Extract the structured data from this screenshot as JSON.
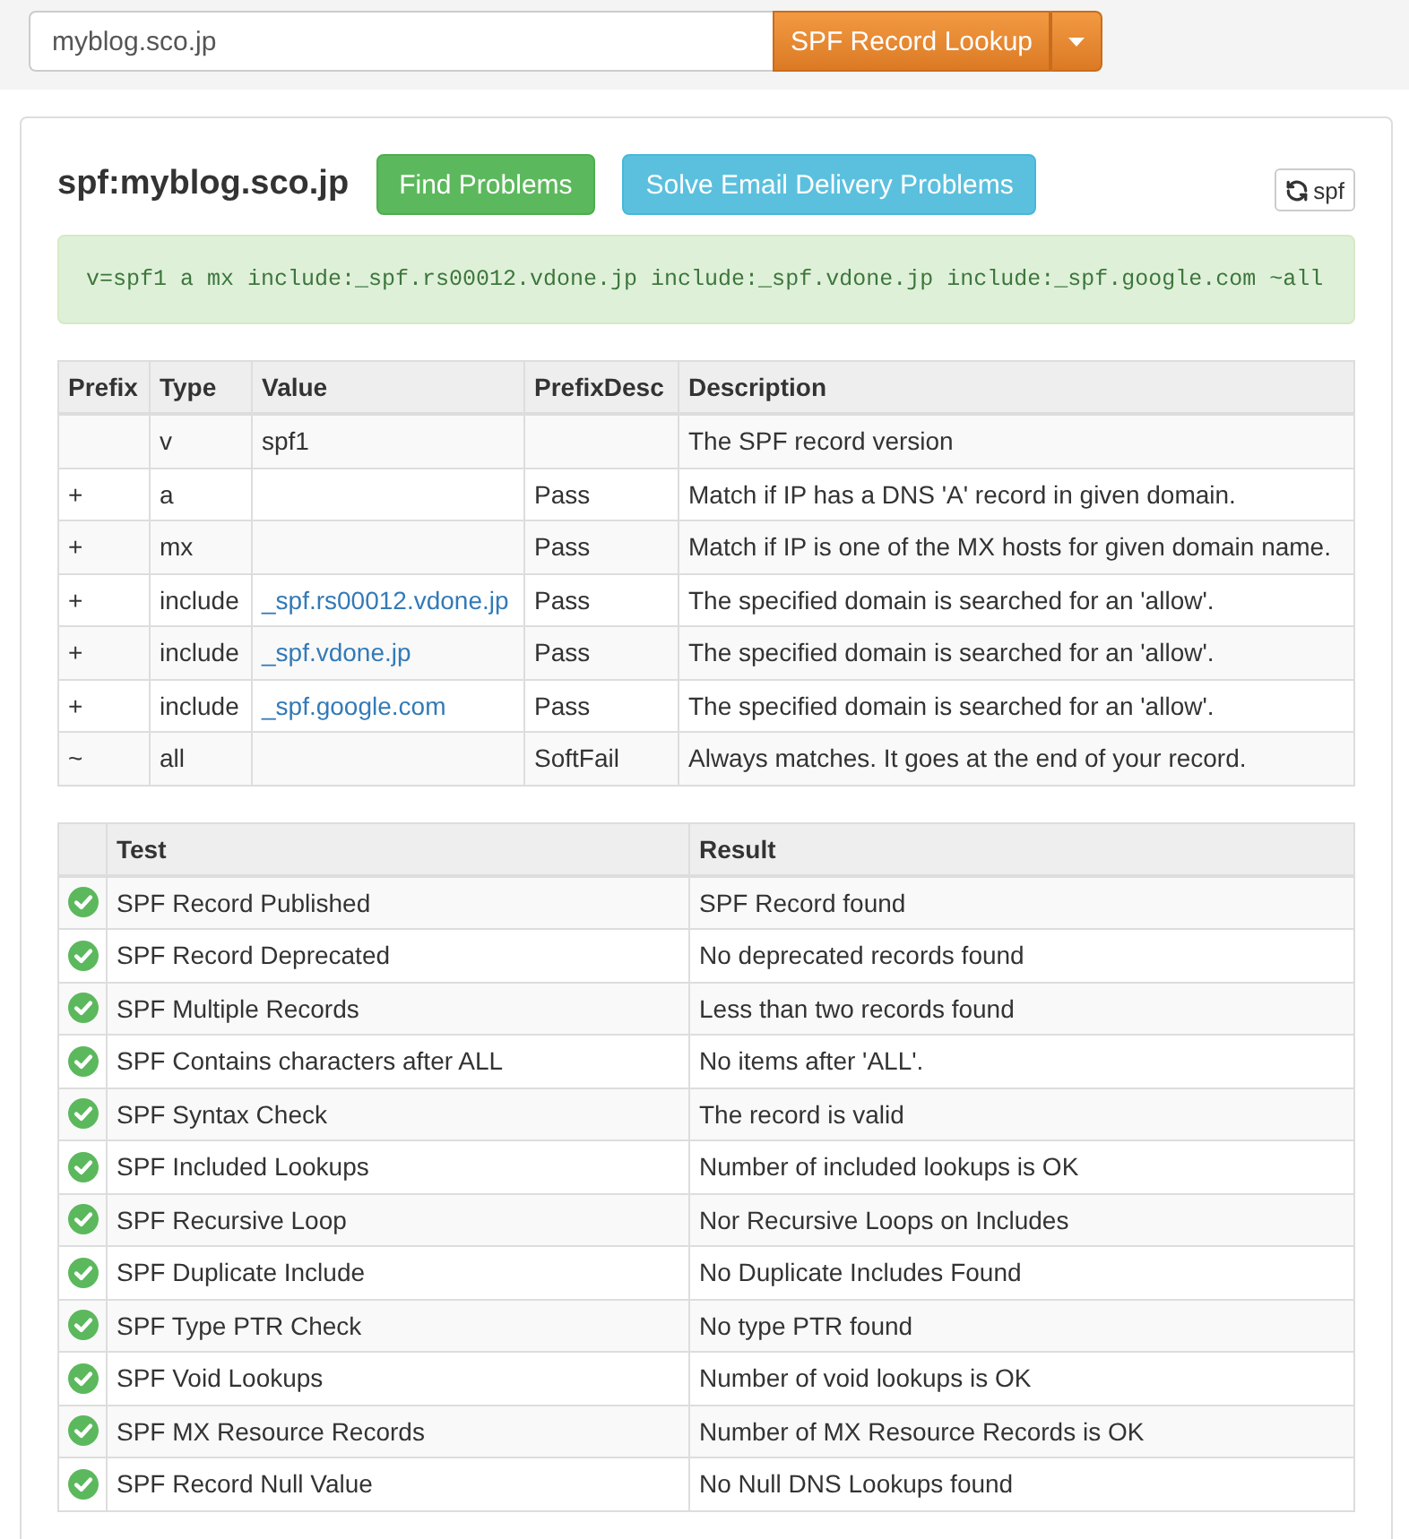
{
  "search": {
    "value": "myblog.sco.jp"
  },
  "lookup_button": {
    "label": "SPF Record Lookup"
  },
  "panel": {
    "title": "spf:myblog.sco.jp",
    "actions": [
      {
        "label": "Find Problems",
        "kind": "success"
      },
      {
        "label": "Solve Email Delivery Problems",
        "kind": "info"
      }
    ],
    "tag_button": {
      "label": "spf"
    },
    "record": "v=spf1 a mx include:_spf.rs00012.vdone.jp include:_spf.vdone.jp include:_spf.google.com ~all"
  },
  "records": {
    "columns": [
      "Prefix",
      "Type",
      "Value",
      "PrefixDesc",
      "Description"
    ],
    "rows": [
      {
        "type": "v",
        "value": "spf1",
        "value_link": false,
        "description": "The SPF record version"
      },
      {
        "prefix": "+",
        "type": "a",
        "prefix_desc": "Pass",
        "description": "Match if IP has a DNS 'A' record in given domain."
      },
      {
        "prefix": "+",
        "type": "mx",
        "prefix_desc": "Pass",
        "description": "Match if IP is one of the MX hosts for given domain name."
      },
      {
        "prefix": "+",
        "type": "include",
        "value": "_spf.rs00012.vdone.jp",
        "value_link": true,
        "prefix_desc": "Pass",
        "description": "The specified domain is searched for an 'allow'."
      },
      {
        "prefix": "+",
        "type": "include",
        "value": "_spf.vdone.jp",
        "value_link": true,
        "prefix_desc": "Pass",
        "description": "The specified domain is searched for an 'allow'."
      },
      {
        "prefix": "+",
        "type": "include",
        "value": "_spf.google.com",
        "value_link": true,
        "prefix_desc": "Pass",
        "description": "The specified domain is searched for an 'allow'."
      },
      {
        "prefix": "~",
        "type": "all",
        "prefix_desc": "SoftFail",
        "description": "Always matches. It goes at the end of your record."
      }
    ]
  },
  "tests": {
    "columns": [
      "Test",
      "Result"
    ],
    "rows": [
      {
        "passed": true,
        "test": "SPF Record Published",
        "result": "SPF Record found"
      },
      {
        "passed": true,
        "test": "SPF Record Deprecated",
        "result": "No deprecated records found"
      },
      {
        "passed": true,
        "test": "SPF Multiple Records",
        "result": "Less than two records found"
      },
      {
        "passed": true,
        "test": "SPF Contains characters after ALL",
        "result": "No items after 'ALL'."
      },
      {
        "passed": true,
        "test": "SPF Syntax Check",
        "result": "The record is valid"
      },
      {
        "passed": true,
        "test": "SPF Included Lookups",
        "result": "Number of included lookups is OK"
      },
      {
        "passed": true,
        "test": "SPF Recursive Loop",
        "result": "Nor Recursive Loops on Includes"
      },
      {
        "passed": true,
        "test": "SPF Duplicate Include",
        "result": "No Duplicate Includes Found"
      },
      {
        "passed": true,
        "test": "SPF Type PTR Check",
        "result": "No type PTR found"
      },
      {
        "passed": true,
        "test": "SPF Void Lookups",
        "result": "Number of void lookups is OK"
      },
      {
        "passed": true,
        "test": "SPF MX Resource Records",
        "result": "Number of MX Resource Records is OK"
      },
      {
        "passed": true,
        "test": "SPF Record Null Value",
        "result": "No Null DNS Lookups found"
      }
    ]
  }
}
